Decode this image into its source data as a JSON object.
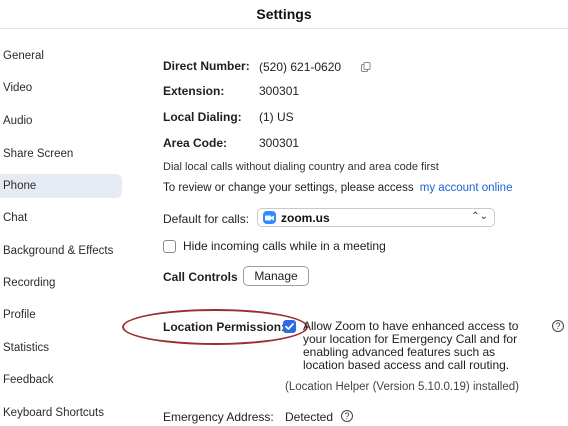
{
  "window": {
    "title": "Settings"
  },
  "sidebar": {
    "items": [
      {
        "label": "General"
      },
      {
        "label": "Video"
      },
      {
        "label": "Audio"
      },
      {
        "label": "Share Screen"
      },
      {
        "label": "Phone",
        "active": true
      },
      {
        "label": "Chat"
      },
      {
        "label": "Background & Effects"
      },
      {
        "label": "Recording"
      },
      {
        "label": "Profile"
      },
      {
        "label": "Statistics"
      },
      {
        "label": "Feedback"
      },
      {
        "label": "Keyboard Shortcuts"
      }
    ]
  },
  "phone": {
    "direct_number_label": "Direct Number:",
    "direct_number_value": "(520) 621-0620",
    "extension_label": "Extension:",
    "extension_value": "300301",
    "local_dialing_label": "Local Dialing:",
    "local_dialing_value": "(1) US",
    "area_code_label": "Area Code:",
    "area_code_value": "300301",
    "dial_note": "Dial local calls without dialing country and area code first",
    "review_text": "To review or change your settings, please access",
    "account_link": "my account online",
    "default_calls_label": "Default for calls:",
    "default_calls_value": "zoom.us",
    "hide_incoming_label": "Hide incoming calls while in a meeting",
    "hide_incoming_checked": false,
    "call_controls_label": "Call Controls",
    "manage_button": "Manage",
    "location_permission_label": "Location Permission:",
    "location_permission_checked": true,
    "location_permission_text": "Allow Zoom to have enhanced access to your location for Emergency Call and for enabling advanced features such as location based access and call routing.",
    "location_helper_text": "(Location Helper (Version 5.10.0.19) installed)",
    "emergency_address_label": "Emergency Address:",
    "emergency_address_value": "Detected"
  },
  "colors": {
    "accent": "#2d6ae3",
    "link": "#1a63d6",
    "annotation": "#9b2e2e",
    "active_sidebar_bg": "#e6ebf3"
  }
}
